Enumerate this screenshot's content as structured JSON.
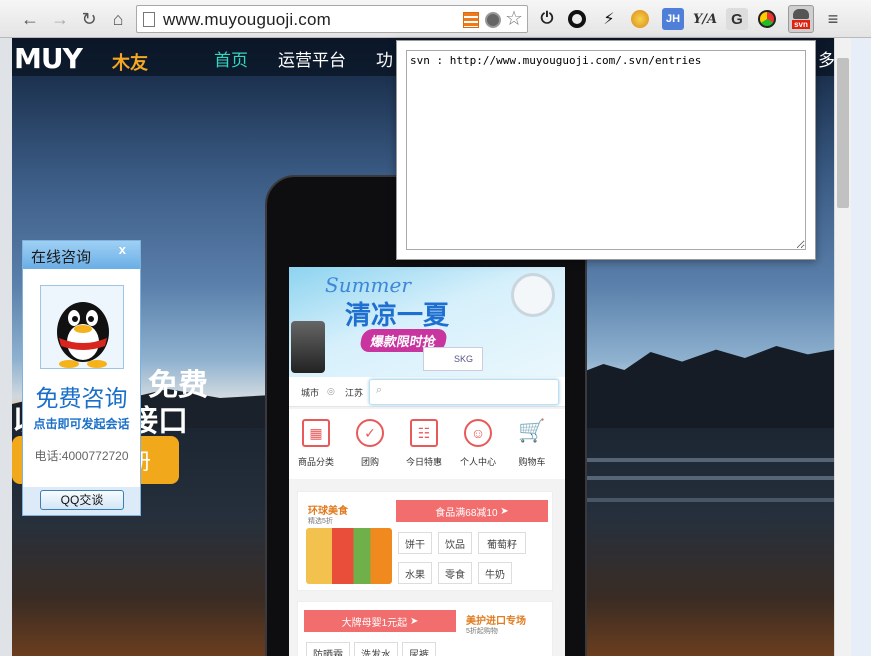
{
  "browser": {
    "url": "www.muyouguoji.com",
    "popup_text": "svn : http://www.muyouguoji.com/.svn/entries",
    "extensions": {
      "jh_label": "JH",
      "svn_label": "svn",
      "g_label": "G"
    }
  },
  "site": {
    "logo": "MUY",
    "logo_cn": "木友",
    "nav": [
      "首页",
      "运营平台",
      "功",
      "多"
    ],
    "hero_line1": "免费",
    "hero_line2": "接口",
    "hero_line2_prefix": "以",
    "hero_button": "册"
  },
  "phone": {
    "banner_summer": "Summer",
    "banner_title": "清凉一夏",
    "banner_badge": "爆款限时抢",
    "banner_brand": "SKG",
    "city_label": "城市",
    "city_value": "江苏",
    "icons": [
      "商品分类",
      "团购",
      "今日特惠",
      "个人中心",
      "购物车"
    ],
    "card1": {
      "title": "环球美食",
      "subtitle": "精选5折",
      "promo": "食品满68减10",
      "chips": [
        "饼干",
        "饮品",
        "葡萄籽",
        "水果",
        "零食",
        "牛奶"
      ]
    },
    "card2": {
      "promo": "大牌母婴1元起",
      "title": "美护进口专场",
      "subtitle": "5折起购物",
      "chips": [
        "防晒霜",
        "洗发水",
        "尿裤"
      ]
    }
  },
  "chat": {
    "title": "在线咨询",
    "close": "x",
    "headline": "免费咨询",
    "cta": "点击即可发起会话",
    "phone": "电话:4000772720",
    "button": "QQ交谈"
  }
}
